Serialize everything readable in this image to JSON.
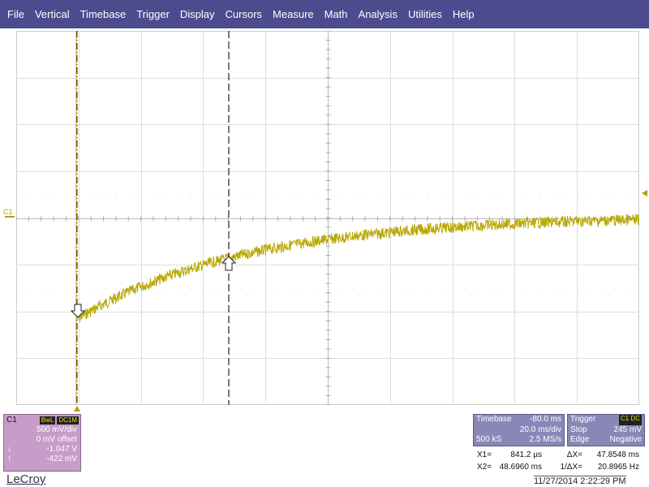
{
  "menu": [
    "File",
    "Vertical",
    "Timebase",
    "Trigger",
    "Display",
    "Cursors",
    "Measure",
    "Math",
    "Analysis",
    "Utilities",
    "Help"
  ],
  "channel_label": "C1",
  "colors": {
    "trace": "#b8a800",
    "menubar": "#4b4b8e",
    "channel_box": "#c89cc8",
    "info_box": "#8a87b8"
  },
  "channel_box": {
    "name": "C1",
    "tag1": "BwL",
    "tag2": "DC1M",
    "volts_div": "500 mV/div",
    "offset": "0 mV offset",
    "cursor1_symbol": "↓",
    "cursor1_value": "-1.047 V",
    "cursor2_symbol": "↑",
    "cursor2_value": "-422 mV"
  },
  "timebase": {
    "label": "Timebase",
    "delay": "-80.0 ms",
    "time_div": "20.0 ms/div",
    "samples": "500 kS",
    "rate": "2.5 MS/s"
  },
  "trigger": {
    "label": "Trigger",
    "tag": "C1 DC",
    "mode": "Stop",
    "level": "245 mV",
    "type": "Edge",
    "slope": "Negative"
  },
  "cursors": {
    "x1_label": "X1=",
    "x1_value": "841.2 µs",
    "dx_label": "ΔX=",
    "dx_value": "47.8548 ms",
    "x2_label": "X2=",
    "x2_value": "48.6960 ms",
    "inv_label": "1/ΔX=",
    "inv_value": "20.8965 Hz"
  },
  "brand": "LeCroy",
  "datetime": "11/27/2014 2:22:29 PM"
}
